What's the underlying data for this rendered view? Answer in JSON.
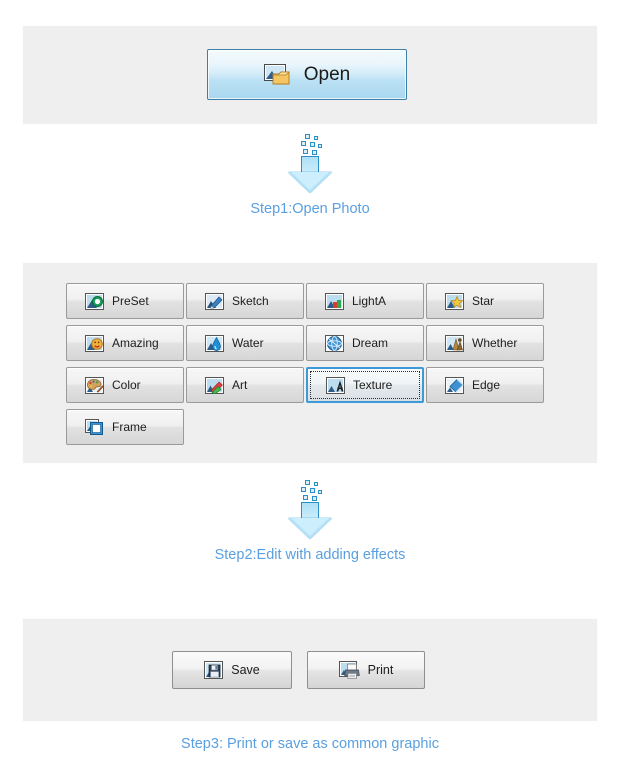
{
  "theme": {
    "page_background": "#ffffff",
    "panel_background": "#efefef",
    "step_text_color": "#5a9fe0",
    "accent_blue": "#3d9ad8",
    "open_button_border": "#3d7fa6",
    "button_text_color": "#1d1d1d"
  },
  "open_section": {
    "button": {
      "label": "Open",
      "icon": "open-folder-image-icon"
    }
  },
  "steps": [
    {
      "id": "step1",
      "label": "Step1:Open Photo",
      "arrow_icon": "dissolving-down-arrow-icon"
    },
    {
      "id": "step2",
      "label": "Step2:Edit with adding effects",
      "arrow_icon": "dissolving-down-arrow-icon"
    },
    {
      "id": "step3",
      "label": "Step3: Print or save as common graphic"
    }
  ],
  "effects_section": {
    "buttons": [
      {
        "label": "PreSet",
        "icon": "preset-photo-icon",
        "selected": false
      },
      {
        "label": "Sketch",
        "icon": "sketch-pencil-icon",
        "selected": false
      },
      {
        "label": "LightA",
        "icon": "light-bars-icon",
        "selected": false
      },
      {
        "label": "Star",
        "icon": "star-icon",
        "selected": false
      },
      {
        "label": "Amazing",
        "icon": "smiley-face-icon",
        "selected": false
      },
      {
        "label": "Water",
        "icon": "water-drop-icon",
        "selected": false
      },
      {
        "label": "Dream",
        "icon": "dream-swirl-icon",
        "selected": false
      },
      {
        "label": "Whether",
        "icon": "weather-icon",
        "selected": false
      },
      {
        "label": "Color",
        "icon": "color-palette-icon",
        "selected": false
      },
      {
        "label": "Art",
        "icon": "art-brush-icon",
        "selected": false
      },
      {
        "label": "Texture",
        "icon": "texture-letter-a-icon",
        "selected": true
      },
      {
        "label": "Edge",
        "icon": "edge-diamond-icon",
        "selected": false
      },
      {
        "label": "Frame",
        "icon": "frame-icon",
        "selected": false
      }
    ]
  },
  "output_section": {
    "buttons": [
      {
        "label": "Save",
        "icon": "floppy-disk-icon"
      },
      {
        "label": "Print",
        "icon": "printer-icon"
      }
    ]
  }
}
